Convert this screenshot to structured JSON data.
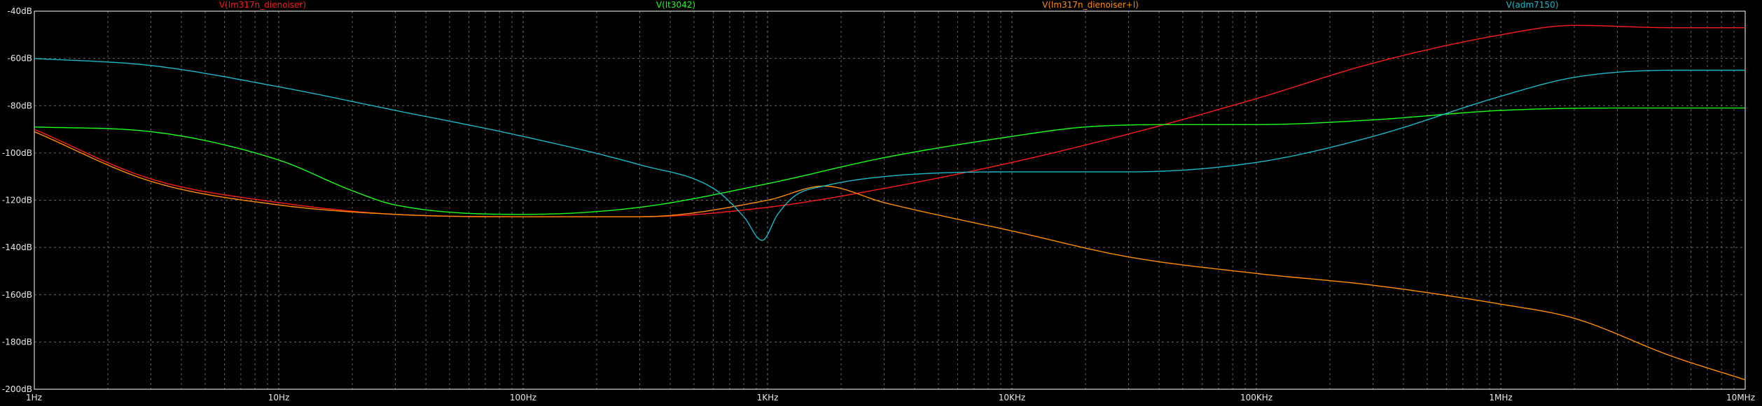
{
  "chart_data": {
    "type": "line",
    "title": "",
    "xlabel": "",
    "ylabel": "",
    "x_scale": "log",
    "xlim": [
      1,
      10000000
    ],
    "ylim": [
      -200,
      -40
    ],
    "grid": true,
    "legend_placement": "top",
    "x_ticks": [
      {
        "value": 1,
        "label": "1Hz"
      },
      {
        "value": 10,
        "label": "10Hz"
      },
      {
        "value": 100,
        "label": "100Hz"
      },
      {
        "value": 1000,
        "label": "1KHz"
      },
      {
        "value": 10000,
        "label": "10KHz"
      },
      {
        "value": 100000,
        "label": "100KHz"
      },
      {
        "value": 1000000,
        "label": "1MHz"
      },
      {
        "value": 10000000,
        "label": "10MHz"
      }
    ],
    "y_ticks": [
      {
        "value": -40,
        "label": "-40dB"
      },
      {
        "value": -60,
        "label": "-60dB"
      },
      {
        "value": -80,
        "label": "-80dB"
      },
      {
        "value": -100,
        "label": "-100dB"
      },
      {
        "value": -120,
        "label": "-120dB"
      },
      {
        "value": -140,
        "label": "-140dB"
      },
      {
        "value": -160,
        "label": "-160dB"
      },
      {
        "value": -180,
        "label": "-180dB"
      },
      {
        "value": -200,
        "label": "-200dB"
      }
    ],
    "series": [
      {
        "name": "V(lm317n_dienoiser)",
        "color": "#ff1a1a",
        "x": [
          1,
          3,
          10,
          30,
          100,
          300,
          1000,
          3000,
          10000,
          30000,
          100000,
          300000,
          1000000,
          2000000,
          5000000,
          10000000
        ],
        "y": [
          -90,
          -111,
          -121,
          -126,
          -127,
          -127,
          -123,
          -115,
          -104,
          -92,
          -77,
          -62,
          -50,
          -46,
          -47,
          -47
        ]
      },
      {
        "name": "V(lt3042)",
        "color": "#1aff1a",
        "x": [
          1,
          3,
          10,
          20,
          30,
          100,
          300,
          1000,
          3000,
          10000,
          20000,
          50000,
          100000,
          300000,
          1000000,
          3000000,
          10000000
        ],
        "y": [
          -89,
          -91,
          -103,
          -116,
          -122,
          -126,
          -123,
          -113,
          -102,
          -93,
          -89,
          -88,
          -88,
          -86,
          -82,
          -81,
          -81
        ]
      },
      {
        "name": "V(lm317n_dienoiser+l)",
        "color": "#ff8c00",
        "x": [
          1,
          3,
          10,
          30,
          100,
          300,
          1000,
          1700,
          3000,
          10000,
          30000,
          100000,
          300000,
          1000000,
          2000000,
          5000000,
          10000000
        ],
        "y": [
          -91,
          -112,
          -122,
          -126,
          -127,
          -127,
          -120,
          -114,
          -121,
          -133,
          -144,
          -151,
          -156,
          -164,
          -170,
          -186,
          -196
        ]
      },
      {
        "name": "V(adm7150)",
        "color": "#1ab8c8",
        "x": [
          1,
          3,
          10,
          30,
          100,
          300,
          600,
          800,
          950,
          1100,
          1300,
          1700,
          3000,
          10000,
          30000,
          100000,
          300000,
          1000000,
          2000000,
          5000000,
          10000000
        ],
        "y": [
          -60,
          -63,
          -72,
          -82,
          -93,
          -105,
          -115,
          -127,
          -137,
          -126,
          -118,
          -114,
          -110,
          -108,
          -108,
          -104,
          -93,
          -76,
          -68,
          -65,
          -65
        ]
      }
    ]
  }
}
